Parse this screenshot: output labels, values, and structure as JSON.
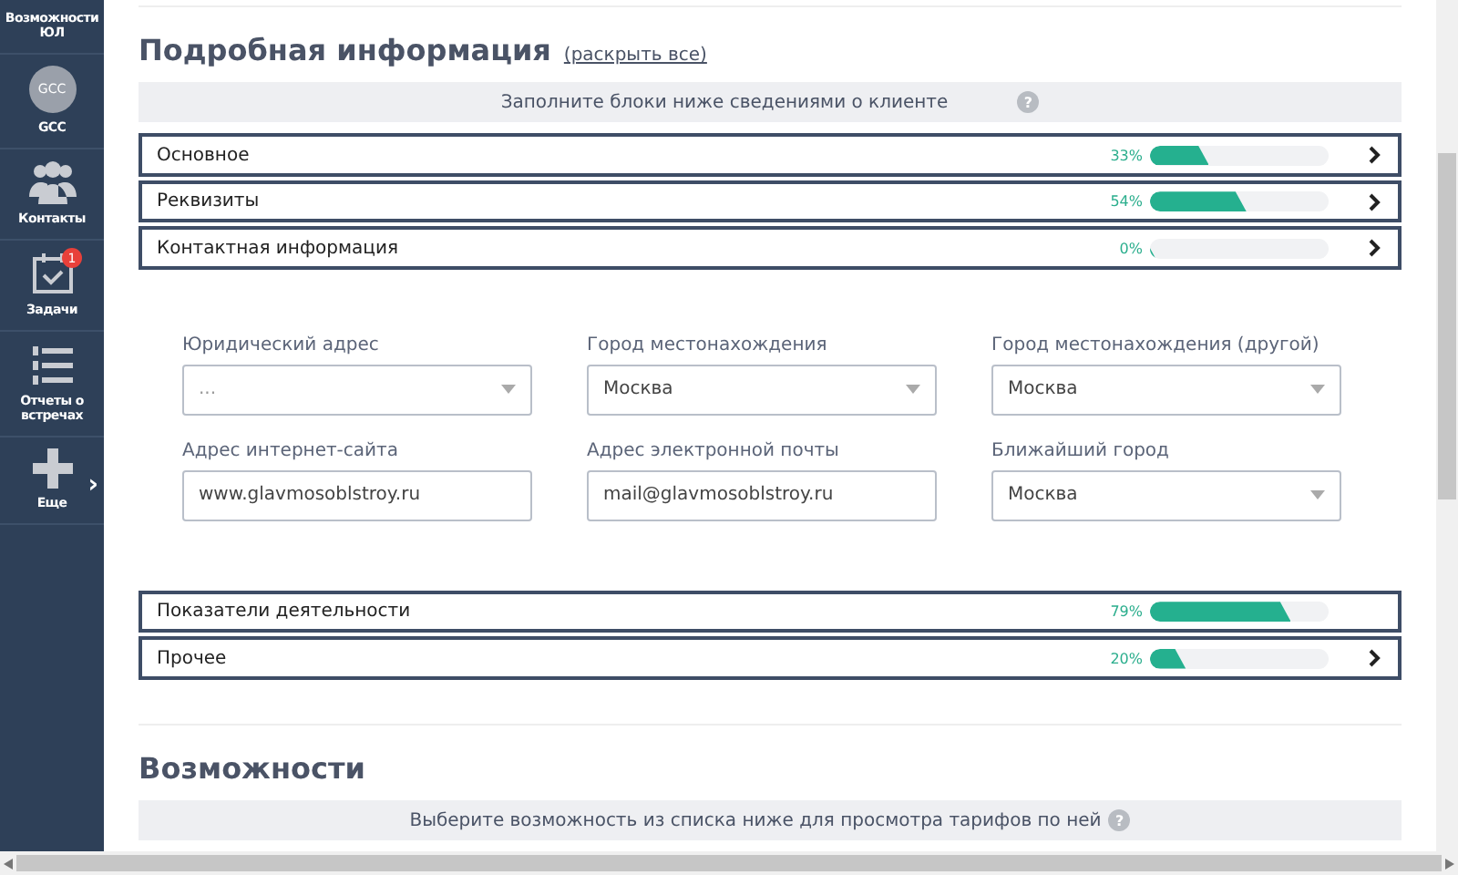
{
  "sidebar": {
    "items": [
      {
        "label": "Возможности ЮЛ",
        "kind": "text"
      },
      {
        "label": "GCC",
        "kind": "avatar",
        "avatar_text": "GCC"
      },
      {
        "label": "Контакты",
        "kind": "people"
      },
      {
        "label": "Задачи",
        "kind": "calendar",
        "badge": "1"
      },
      {
        "label": "Отчеты о встречах",
        "kind": "list"
      },
      {
        "label": "Еще",
        "kind": "plus",
        "more": "›"
      }
    ]
  },
  "details": {
    "title": "Подробная информация",
    "expand_link": "(раскрыть все)",
    "hint": "Заполните блоки ниже сведениями о клиенте",
    "help": "?",
    "sections": [
      {
        "name": "Основное",
        "percent": "33%",
        "level": 0.33,
        "chevron": true
      },
      {
        "name": "Реквизиты",
        "percent": "54%",
        "level": 0.54,
        "chevron": true
      },
      {
        "name": "Контактная информация",
        "percent": "0%",
        "level": 0.0,
        "chevron": true,
        "expanded": true,
        "fields": [
          {
            "label": "Юридический адрес",
            "kind": "select",
            "placeholder": "..."
          },
          {
            "label": "Город местонахождения",
            "kind": "select",
            "value": "Москва"
          },
          {
            "label": "Город местонахождения (другой)",
            "kind": "select",
            "value": "Москва"
          },
          {
            "label": "Адрес интернет-сайта",
            "kind": "text",
            "value": "www.glavmosoblstroy.ru"
          },
          {
            "label": "Адрес электронной почты",
            "kind": "text",
            "value": "mail@glavmosoblstroy.ru"
          },
          {
            "label": "Ближайший город",
            "kind": "select",
            "value": "Москва"
          }
        ]
      },
      {
        "name": "Показатели деятельности",
        "percent": "79%",
        "level": 0.79,
        "chevron": false
      },
      {
        "name": "Прочее",
        "percent": "20%",
        "level": 0.2,
        "chevron": true
      }
    ]
  },
  "features": {
    "title": "Возможности",
    "hint": "Выберите возможность из списка ниже для просмотра тарифов по ней",
    "help": "?"
  }
}
